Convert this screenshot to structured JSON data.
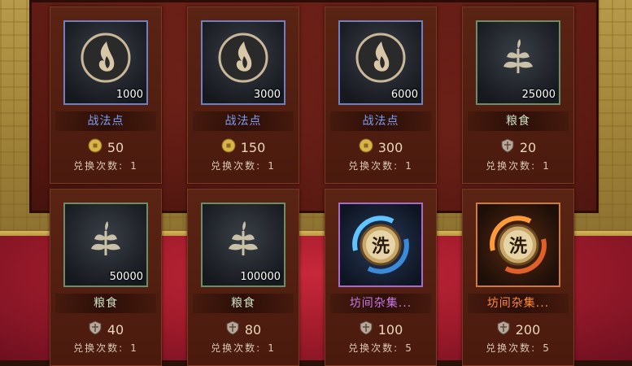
{
  "colors": {
    "name_blue": "#7f9cf0",
    "name_green": "#cfe0c4",
    "name_purple": "#c678e6",
    "name_orange": "#ff8a3a",
    "coin_gold": "#d9b44a",
    "shield_gray": "#b9a89a"
  },
  "row1": [
    {
      "name": "战法点",
      "quantity": "1000",
      "price": "50",
      "currency": "coin-icon",
      "limit_label": "兑换次数:",
      "limit": "1",
      "icon": "tactic-point-icon",
      "rarity": "blue"
    },
    {
      "name": "战法点",
      "quantity": "3000",
      "price": "150",
      "currency": "coin-icon",
      "limit_label": "兑换次数:",
      "limit": "1",
      "icon": "tactic-point-icon",
      "rarity": "blue"
    },
    {
      "name": "战法点",
      "quantity": "6000",
      "price": "300",
      "currency": "coin-icon",
      "limit_label": "兑换次数:",
      "limit": "1",
      "icon": "tactic-point-icon",
      "rarity": "blue"
    },
    {
      "name": "粮食",
      "quantity": "25000",
      "price": "20",
      "currency": "shield-icon",
      "limit_label": "兑换次数:",
      "limit": "1",
      "icon": "grain-icon",
      "rarity": "green"
    }
  ],
  "row2": [
    {
      "name": "粮食",
      "quantity": "50000",
      "price": "40",
      "currency": "shield-icon",
      "limit_label": "兑换次数:",
      "limit": "1",
      "icon": "grain-icon",
      "rarity": "green"
    },
    {
      "name": "粮食",
      "quantity": "100000",
      "price": "80",
      "currency": "shield-icon",
      "limit_label": "兑换次数:",
      "limit": "1",
      "icon": "grain-icon",
      "rarity": "green"
    },
    {
      "name": "坊间杂集...",
      "price": "100",
      "currency": "shield-icon",
      "limit_label": "兑换次数:",
      "limit": "5",
      "icon": "wash-token-blue-icon",
      "icon_char": "洗",
      "rarity": "purple"
    },
    {
      "name": "坊间杂集...",
      "price": "200",
      "currency": "shield-icon",
      "limit_label": "兑换次数:",
      "limit": "5",
      "icon": "wash-token-orange-icon",
      "icon_char": "洗",
      "rarity": "orange"
    }
  ]
}
